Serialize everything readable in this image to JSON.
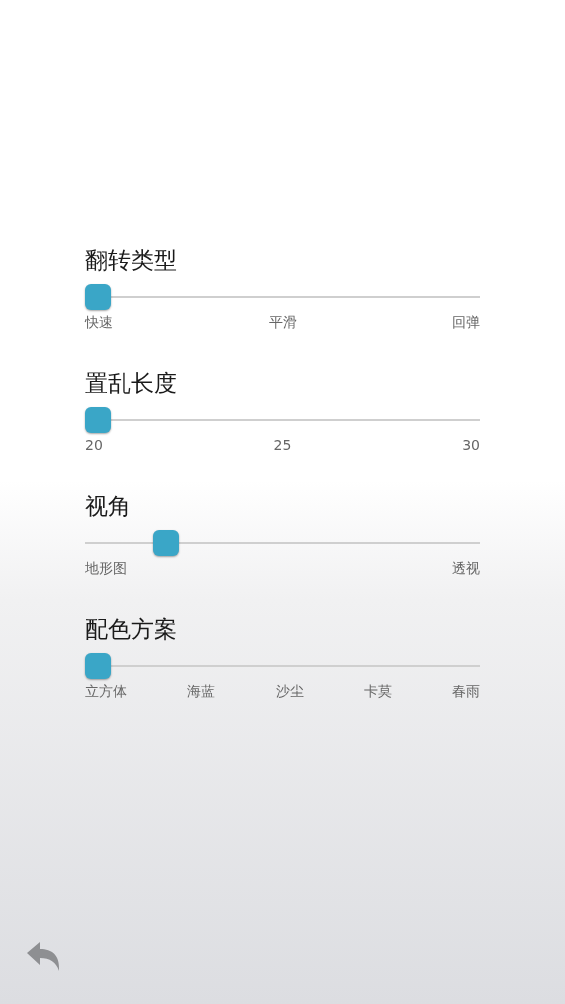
{
  "settings": [
    {
      "title": "翻转类型",
      "level": 0,
      "labels": [
        "快速",
        "平滑",
        "回弹"
      ]
    },
    {
      "title": "置乱长度",
      "level": 0,
      "labels": [
        "20",
        "25",
        "30"
      ]
    },
    {
      "title": "视角",
      "level": 0.185,
      "labels": [
        "地形图",
        "透视"
      ]
    },
    {
      "title": "配色方案",
      "level": 0,
      "labels": [
        "立方体",
        "海蓝",
        "沙尘",
        "卡莫",
        "春雨"
      ]
    }
  ]
}
